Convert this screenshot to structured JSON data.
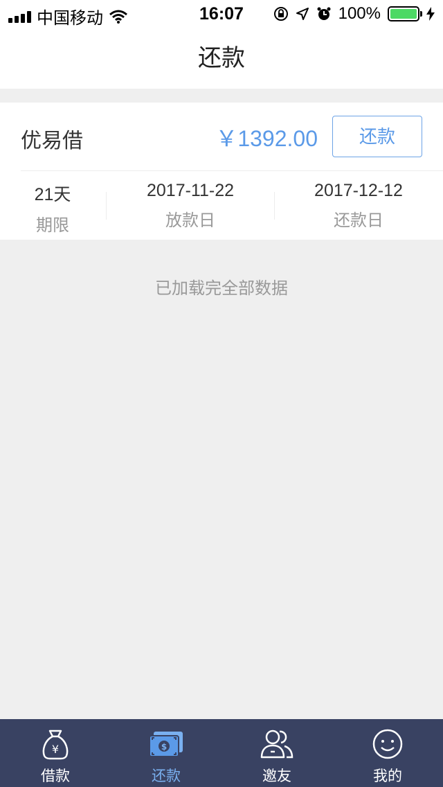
{
  "status_bar": {
    "carrier": "中国移动",
    "time": "16:07",
    "battery": "100%"
  },
  "nav": {
    "title": "还款"
  },
  "loan": {
    "lender": "优易借",
    "amount": "￥1392.00",
    "repay_label": "还款",
    "term_value": "21天",
    "term_label": "期限",
    "disburse_date": "2017-11-22",
    "disburse_label": "放款日",
    "repay_date": "2017-12-12",
    "repay_date_label": "还款日"
  },
  "list_footer": {
    "text": "已加载完全部数据"
  },
  "tabs": [
    {
      "label": "借款",
      "icon": "money-bag-icon",
      "active": false
    },
    {
      "label": "还款",
      "icon": "banknote-icon",
      "active": true
    },
    {
      "label": "邀友",
      "icon": "friends-icon",
      "active": false
    },
    {
      "label": "我的",
      "icon": "smiley-icon",
      "active": false
    }
  ],
  "colors": {
    "accent": "#5b9ae8",
    "tab_bar": "#394262",
    "battery": "#4cd964"
  }
}
